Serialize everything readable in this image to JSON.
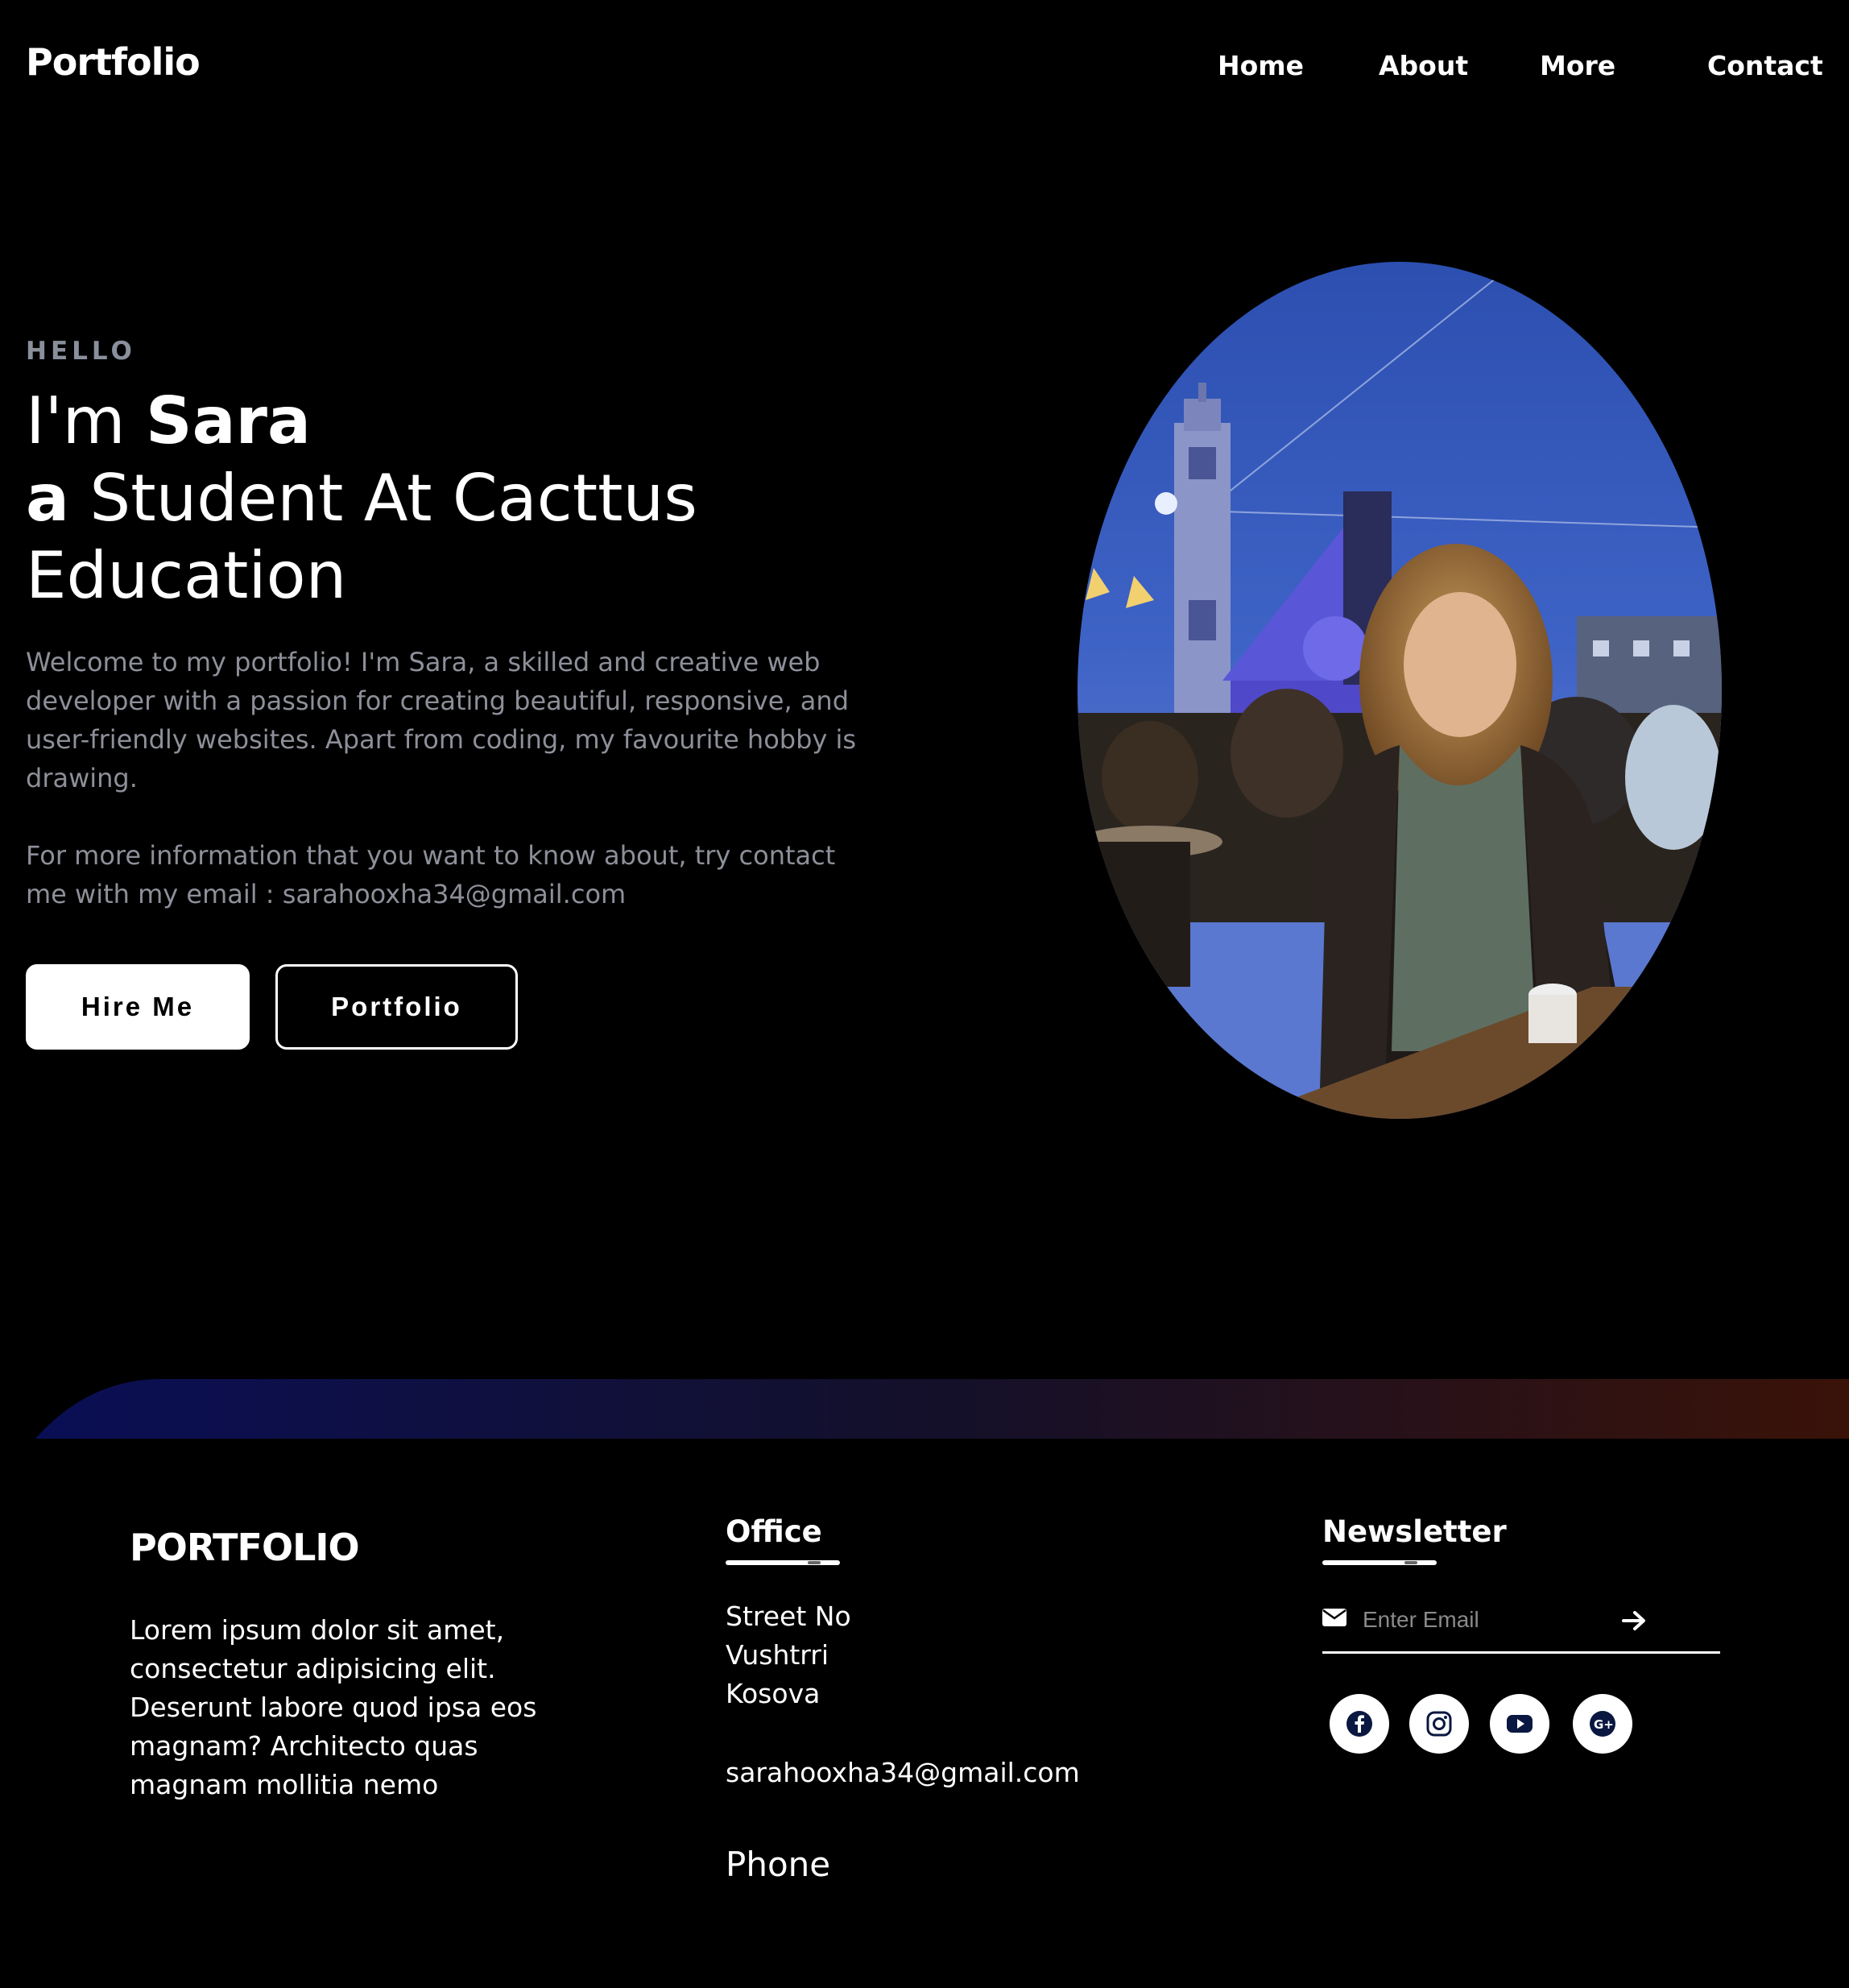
{
  "nav": {
    "logo": "Portfolio",
    "items": [
      "Home",
      "About",
      "More",
      "Contact"
    ]
  },
  "hero": {
    "greeting": "HELLO",
    "line1_prefix": "I'm ",
    "name": "Sara",
    "line2_bold": "a",
    "line2_rest": " Student At Cacttus",
    "line3": "Education",
    "paragraph1": "Welcome to my portfolio! I'm Sara, a skilled and creative web developer with a passion for creating beautiful, responsive, and user-friendly websites. Apart from coding, my favourite hobby is drawing.",
    "paragraph2": "For more information that you want to know about, try contact me with my email : sarahooxha34@gmail.com",
    "hire_button": "Hire Me",
    "portfolio_button": "Portfolio"
  },
  "footer": {
    "brand": {
      "title": "PORTFOLIO",
      "text": "Lorem ipsum dolor sit amet, consectetur adipisicing elit. Deserunt labore quod ipsa eos magnam? Architecto quas magnam mollitia nemo"
    },
    "office": {
      "title": "Office",
      "address": [
        "Street No",
        "Vushtrri",
        "Kosova"
      ],
      "email": "sarahooxha34@gmail.com",
      "phone": "Phone"
    },
    "newsletter": {
      "title": "Newsletter",
      "placeholder": "Enter Email",
      "socials": [
        "facebook-icon",
        "instagram-icon",
        "youtube-icon",
        "google-plus-icon"
      ]
    }
  },
  "colors": {
    "background": "#000000",
    "muted_text": "#8d8f99",
    "icon_navy": "#0a1740",
    "wave_left": "#0a0f55",
    "wave_right": "#3a1208"
  }
}
